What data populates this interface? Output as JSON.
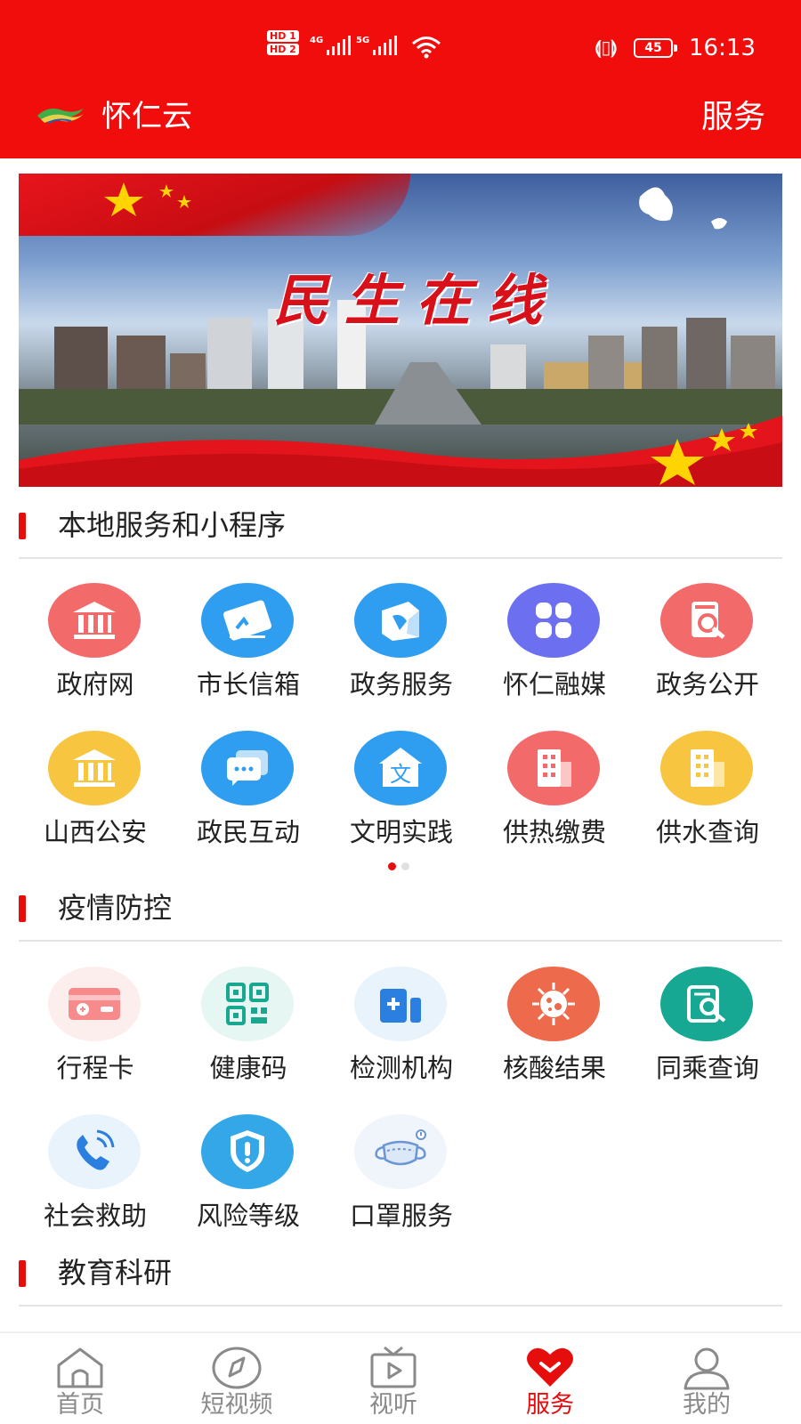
{
  "status_bar": {
    "hd_1": "HD 1",
    "hd_2": "HD 2",
    "net_1": "4G",
    "net_2": "5G",
    "battery": "45",
    "time": "16:13"
  },
  "header": {
    "title": "怀仁云",
    "right_label": "服务"
  },
  "banner": {
    "slogan": "民生在线"
  },
  "sections": [
    {
      "title": "本地服务和小程序",
      "items": [
        {
          "label": "政府网",
          "icon": "bank-icon",
          "color": "#f36a6a"
        },
        {
          "label": "市长信箱",
          "icon": "envelope-pen-icon",
          "color": "#2f9ef0"
        },
        {
          "label": "政务服务",
          "icon": "service-box-icon",
          "color": "#2f9ef0"
        },
        {
          "label": "怀仁融媒",
          "icon": "grid-icon",
          "color": "#6b6ff0"
        },
        {
          "label": "政务公开",
          "icon": "document-search-icon",
          "color": "#f36a6a"
        },
        {
          "label": "山西公安",
          "icon": "bank-icon",
          "color": "#f7c540"
        },
        {
          "label": "政民互动",
          "icon": "chat-icon",
          "color": "#2f9ef0"
        },
        {
          "label": "文明实践",
          "icon": "house-text-icon",
          "color": "#2f9ef0"
        },
        {
          "label": "供热缴费",
          "icon": "building-icon",
          "color": "#f36a6a"
        },
        {
          "label": "供水查询",
          "icon": "building-icon",
          "color": "#f7c540"
        }
      ],
      "page_count": 2,
      "active_page": 1
    },
    {
      "title": "疫情防控",
      "items": [
        {
          "label": "行程卡",
          "icon": "card-icon",
          "color": "#fdeeee"
        },
        {
          "label": "健康码",
          "icon": "qr-code-icon",
          "color": "#e6f6f2"
        },
        {
          "label": "检测机构",
          "icon": "medical-kit-icon",
          "color": "#e9f3fc"
        },
        {
          "label": "核酸结果",
          "icon": "virus-icon",
          "color": "#ee6a4d"
        },
        {
          "label": "同乘查询",
          "icon": "document-search-icon",
          "color": "#16a892"
        },
        {
          "label": "社会救助",
          "icon": "phone-call-icon",
          "color": "#e9f3fc"
        },
        {
          "label": "风险等级",
          "icon": "shield-alert-icon",
          "color": "#34a7e8"
        },
        {
          "label": "口罩服务",
          "icon": "mask-icon",
          "color": "#f0f5fb"
        }
      ]
    },
    {
      "title": "教育科研"
    }
  ],
  "bottom_nav": [
    {
      "label": "首页",
      "icon": "home-icon"
    },
    {
      "label": "短视频",
      "icon": "compass-icon"
    },
    {
      "label": "视听",
      "icon": "tv-icon"
    },
    {
      "label": "服务",
      "icon": "heart-icon",
      "active": true
    },
    {
      "label": "我的",
      "icon": "user-icon"
    }
  ],
  "colors": {
    "brand_red": "#f20d0d",
    "accent_red": "#e60d0d",
    "nav_inactive": "#8a8a8a"
  }
}
